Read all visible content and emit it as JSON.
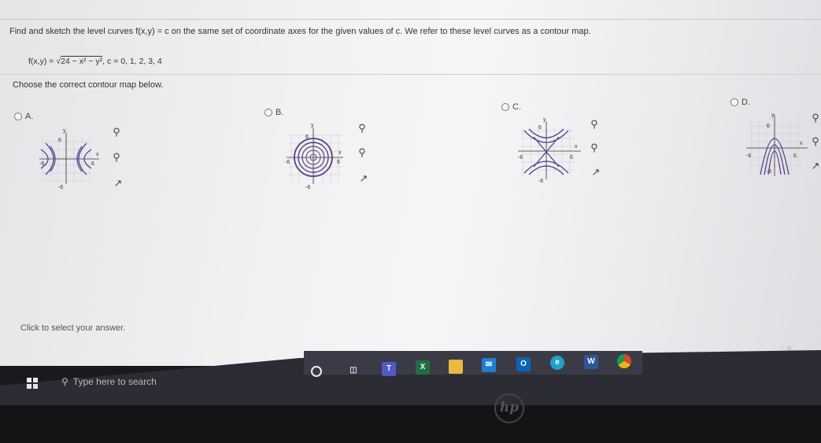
{
  "question": {
    "text": "Find and sketch the level curves f(x,y) = c on the same set of coordinate axes for the given values of c. We refer to these level curves as a contour map.",
    "formula_lhs": "f(x,y) = ",
    "formula_root": "24 − x² − y²",
    "formula_rhs": ", c = 0, 1, 2, 3, 4"
  },
  "prompt": "Choose the correct contour map below.",
  "choices": [
    {
      "letter": "A.",
      "tick_pos": "6",
      "tick_neg": "-6",
      "xlabel": "x",
      "ylabel": "y"
    },
    {
      "letter": "B.",
      "tick_pos": "6",
      "tick_neg": "-6",
      "xlabel": "x",
      "ylabel": "y"
    },
    {
      "letter": "C.",
      "tick_pos": "6",
      "tick_neg": "-6",
      "xlabel": "x",
      "ylabel": "y"
    },
    {
      "letter": "D.",
      "tick_pos": "6",
      "tick_neg": "-6",
      "xlabel": "x",
      "ylabel": "y"
    }
  ],
  "click_hint": "Click to select your answer.",
  "taskbar": {
    "search_placeholder": "Type here to search",
    "icons": [
      "cortana-icon",
      "task-view-icon",
      "teams-icon",
      "excel-icon",
      "file-explorer-icon",
      "mail-icon",
      "outlook-icon",
      "edge-icon",
      "word-icon",
      "chrome-icon"
    ]
  },
  "colors": {
    "curve": "#5a3d8c",
    "grid": "#c9c9d6",
    "accent": "#0078d4"
  },
  "brand": "hp"
}
